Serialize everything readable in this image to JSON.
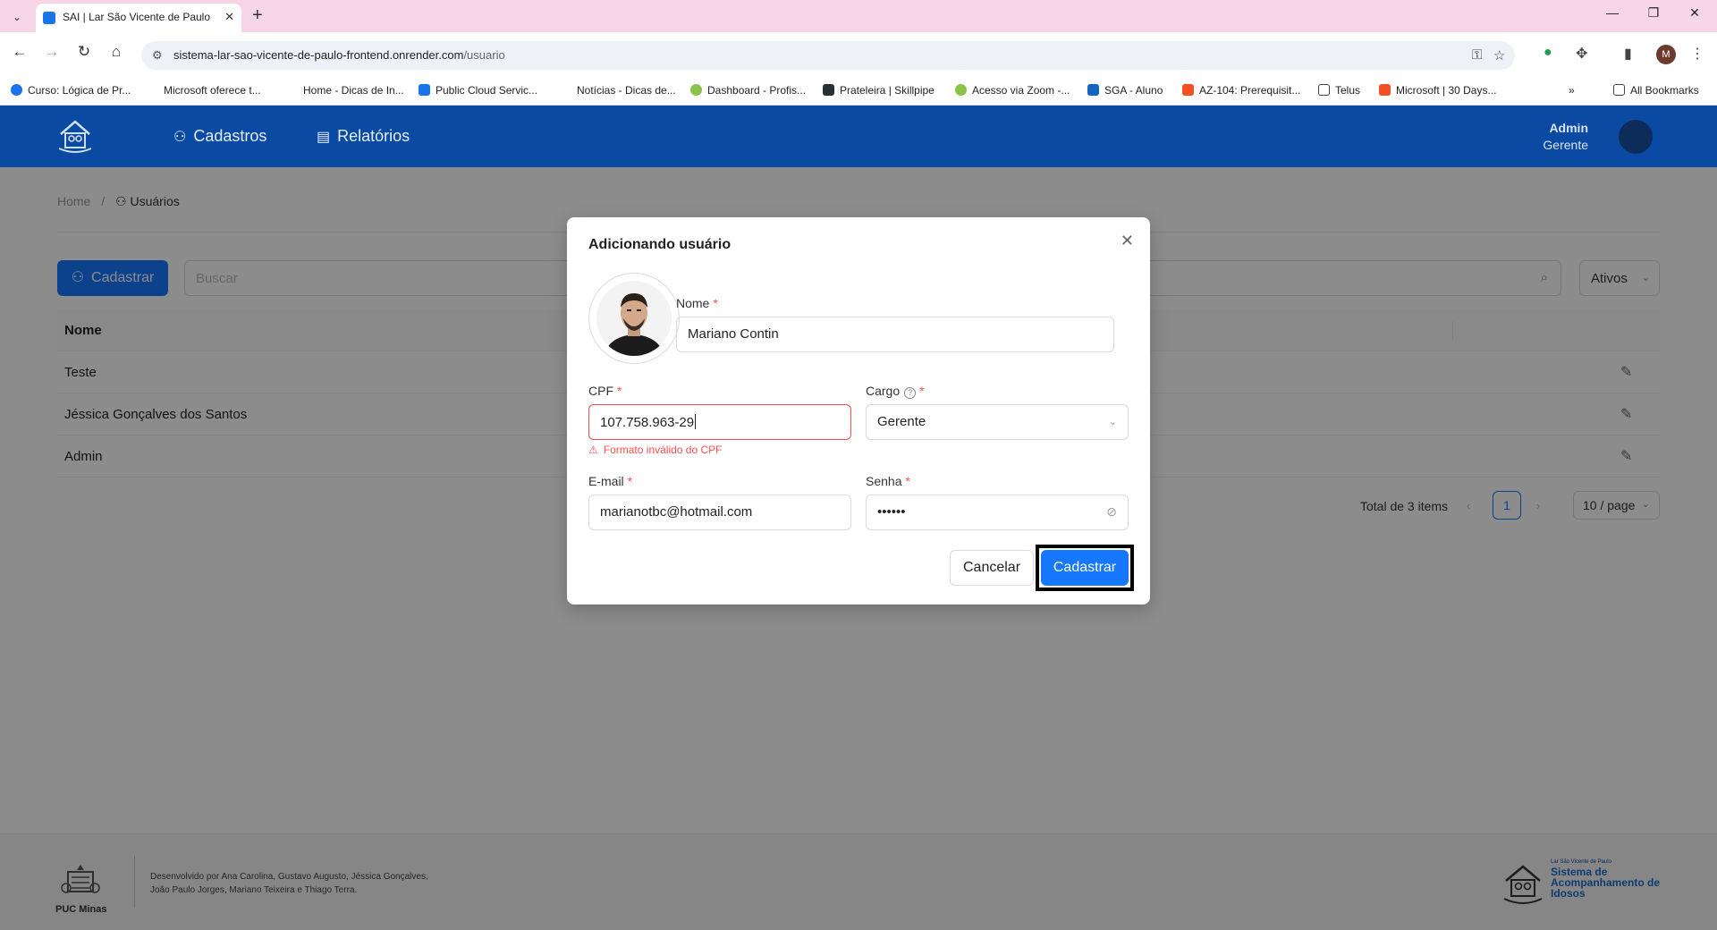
{
  "browser": {
    "tab_title": "SAI | Lar São Vicente de Paulo",
    "url_domain": "sistema-lar-sao-vicente-de-paulo-frontend.onrender.com",
    "url_path": "/usuario",
    "profile_initial": "M",
    "bookmarks": [
      {
        "label": "Curso: Lógica de Pr...",
        "color": "#1a73e8"
      },
      {
        "label": "Microsoft oferece t...",
        "color": "#ffffff"
      },
      {
        "label": "Home - Dicas de In...",
        "color": "#ffffff"
      },
      {
        "label": "Public Cloud Servic...",
        "color": "#1a73e8"
      },
      {
        "label": "Notícias - Dicas de...",
        "color": "#ffffff"
      },
      {
        "label": "Dashboard - Profis...",
        "color": "#8bc34a"
      },
      {
        "label": "Prateleira | Skillpipe",
        "color": "#263238"
      },
      {
        "label": "Acesso via Zoom -...",
        "color": "#8bc34a"
      },
      {
        "label": "SGA - Aluno",
        "color": "#1565c0"
      },
      {
        "label": "AZ-104: Prerequisit...",
        "color": "#f25022"
      },
      {
        "label": "Telus",
        "color": "#ffffff"
      },
      {
        "label": "Microsoft | 30 Days...",
        "color": "#f25022"
      }
    ],
    "all_bookmarks": "All Bookmarks"
  },
  "app": {
    "menu": [
      {
        "label": "Cadastros",
        "icon": "user-icon"
      },
      {
        "label": "Relatórios",
        "icon": "file-icon"
      }
    ],
    "user": {
      "name": "Admin",
      "role": "Gerente"
    },
    "breadcrumb": {
      "home": "Home",
      "separator": "/",
      "current": "Usuários"
    },
    "toolbar": {
      "add_label": "Cadastrar",
      "search_placeholder": "Buscar",
      "filter_value": "Ativos"
    },
    "table": {
      "header_name": "Nome",
      "rows": [
        "Teste",
        "Jéssica Gonçalves dos Santos",
        "Admin"
      ]
    },
    "pagination": {
      "total": "Total de 3 items",
      "current_page": "1",
      "page_size": "10 / page"
    },
    "footer": {
      "puc": "PUC Minas",
      "credits_line1": "Desenvolvido por Ana Carolina, Gustavo Augusto, Jéssica Gonçalves,",
      "credits_line2": "João Paulo Jorges, Mariano Teixeira e Thiago Terra.",
      "sai_small": "Lar São Vicente de Paulo",
      "sai_big": "Sistema de Acompanhamento de Idosos"
    }
  },
  "modal": {
    "title": "Adicionando usuário",
    "fields": {
      "nome": {
        "label": "Nome",
        "value": "Mariano Contin"
      },
      "cpf": {
        "label": "CPF",
        "value": "107.758.963-29",
        "error": "Formato inválido do CPF"
      },
      "cargo": {
        "label": "Cargo",
        "value": "Gerente"
      },
      "email": {
        "label": "E-mail",
        "value": "marianotbc@hotmail.com"
      },
      "senha": {
        "label": "Senha",
        "value": "••••••"
      }
    },
    "required_mark": "*",
    "cancel_label": "Cancelar",
    "submit_label": "Cadastrar"
  }
}
